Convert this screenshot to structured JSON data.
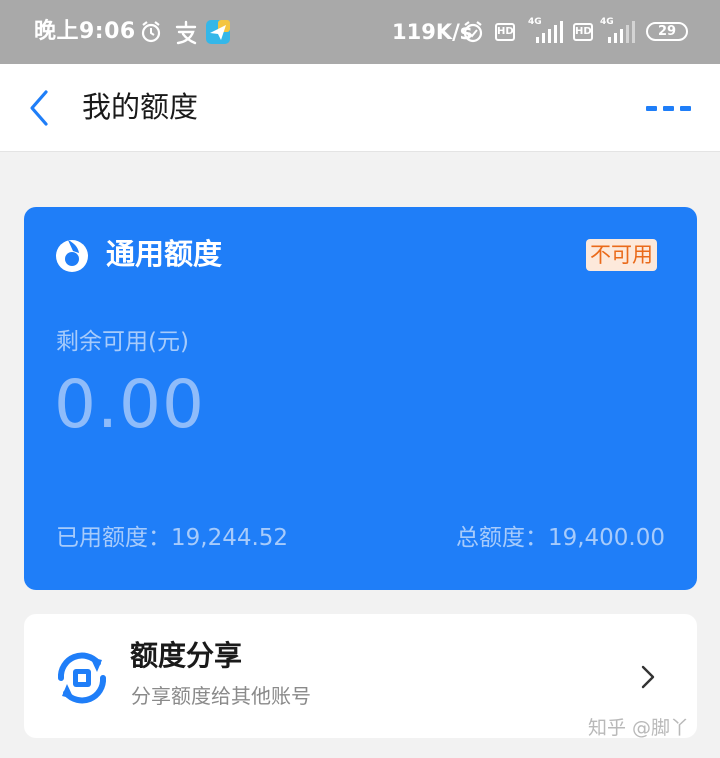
{
  "status_bar": {
    "time": "晚上9:06",
    "net_speed": "119K/s",
    "hd_label": "HD",
    "network_label": "4G",
    "battery": "29",
    "icons": [
      "alarm-icon",
      "alipay-notification-icon",
      "paper-plane-app-icon",
      "alarm-icon",
      "signal-icon",
      "battery-icon"
    ]
  },
  "nav": {
    "title": "我的额度",
    "back_icon": "chevron-left-icon",
    "more_icon": "more-dots-icon",
    "accent_color": "#1f7ef8"
  },
  "credit_card": {
    "title": "通用额度",
    "status_badge": "不可用",
    "remaining_label": "剩余可用(元)",
    "remaining_value": "0.00",
    "used_label": "已用额度：",
    "used_value": "19,244.52",
    "total_label": "总额度：",
    "total_value": "19,400.00",
    "background_color": "#1f7ef8",
    "badge_color": "#ea6a1a"
  },
  "share": {
    "title": "额度分享",
    "subtitle": "分享额度给其他账号",
    "icon": "share-exchange-icon",
    "chevron_icon": "chevron-right-icon"
  },
  "watermark": "知乎 @脚丫"
}
